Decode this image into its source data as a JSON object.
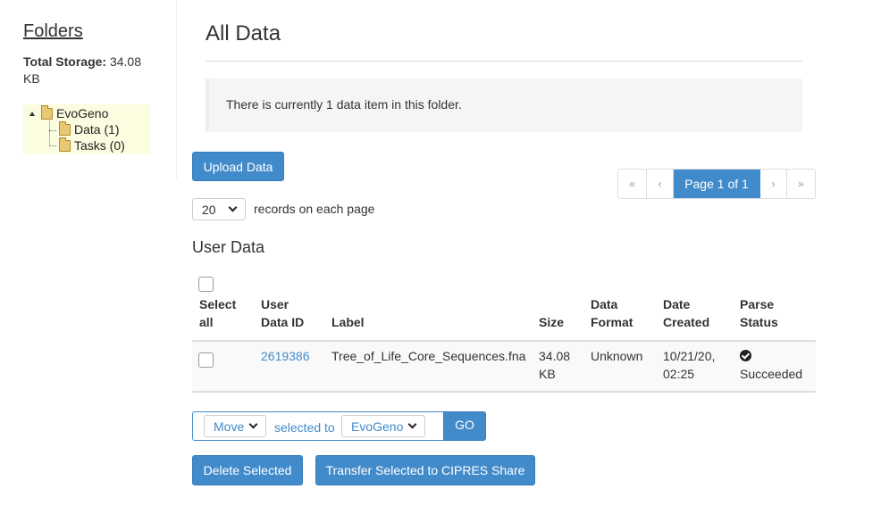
{
  "sidebar": {
    "heading": "Folders",
    "storage_label": "Total Storage:",
    "storage_value": "34.08 KB",
    "tree": {
      "root": "EvoGeno",
      "children": [
        {
          "label": "Data (1)"
        },
        {
          "label": "Tasks (0)"
        }
      ]
    }
  },
  "main": {
    "title": "All Data",
    "info_message": "There is currently 1 data item in this folder.",
    "upload_label": "Upload Data",
    "pagination": {
      "first": "«",
      "prev": "‹",
      "current": "Page 1 of 1",
      "next": "›",
      "last": "»"
    },
    "records_per_page": {
      "value": "20",
      "label": "records on each page"
    },
    "section_title": "User Data",
    "table": {
      "headers": {
        "select_all": [
          "Select",
          "all"
        ],
        "user_data_id": [
          "User",
          "Data ID"
        ],
        "label": "Label",
        "size": "Size",
        "data_format": [
          "Data",
          "Format"
        ],
        "date_created": [
          "Date",
          "Created"
        ],
        "parse_status": [
          "Parse",
          "Status"
        ]
      },
      "rows": [
        {
          "id": "2619386",
          "label": "Tree_of_Life_Core_Sequences.fna",
          "size": [
            "34.08",
            "KB"
          ],
          "format": "Unknown",
          "date": [
            "10/21/20,",
            "02:25"
          ],
          "status": "Succeeded"
        }
      ]
    },
    "actions": {
      "move_value": "Move",
      "selected_to": "selected to",
      "target_value": "EvoGeno",
      "go_label": "GO",
      "delete_label": "Delete Selected",
      "transfer_label": "Transfer Selected to CIPRES Share"
    }
  },
  "colors": {
    "primary": "#428bca",
    "tree_bg": "#fcfce0"
  }
}
